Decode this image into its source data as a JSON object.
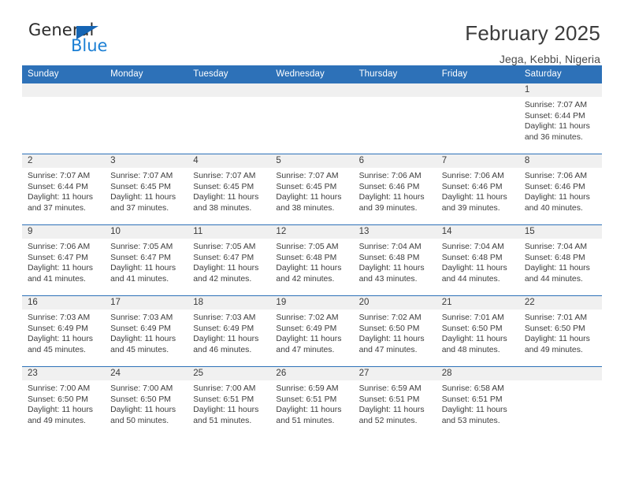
{
  "brand": {
    "word_general": "General",
    "word_blue": "Blue",
    "flag_color": "#1565b4",
    "blue_text_color": "#1b7fd4"
  },
  "header": {
    "title": "February 2025",
    "subtitle": "Jega, Kebbi, Nigeria"
  },
  "theme": {
    "header_blue": "#2d71b8",
    "band_gray": "#f0f0f0",
    "text": "#3a3a3a"
  },
  "weekday_headers": [
    "Sunday",
    "Monday",
    "Tuesday",
    "Wednesday",
    "Thursday",
    "Friday",
    "Saturday"
  ],
  "labels": {
    "sunrise_prefix": "Sunrise:",
    "sunset_prefix": "Sunset:",
    "daylight_prefix": "Daylight:"
  },
  "weeks": [
    [
      {
        "empty": true
      },
      {
        "empty": true
      },
      {
        "empty": true
      },
      {
        "empty": true
      },
      {
        "empty": true
      },
      {
        "empty": true
      },
      {
        "day": "1",
        "sunrise": "Sunrise: 7:07 AM",
        "sunset": "Sunset: 6:44 PM",
        "daylight": "Daylight: 11 hours and 36 minutes."
      }
    ],
    [
      {
        "day": "2",
        "sunrise": "Sunrise: 7:07 AM",
        "sunset": "Sunset: 6:44 PM",
        "daylight": "Daylight: 11 hours and 37 minutes."
      },
      {
        "day": "3",
        "sunrise": "Sunrise: 7:07 AM",
        "sunset": "Sunset: 6:45 PM",
        "daylight": "Daylight: 11 hours and 37 minutes."
      },
      {
        "day": "4",
        "sunrise": "Sunrise: 7:07 AM",
        "sunset": "Sunset: 6:45 PM",
        "daylight": "Daylight: 11 hours and 38 minutes."
      },
      {
        "day": "5",
        "sunrise": "Sunrise: 7:07 AM",
        "sunset": "Sunset: 6:45 PM",
        "daylight": "Daylight: 11 hours and 38 minutes."
      },
      {
        "day": "6",
        "sunrise": "Sunrise: 7:06 AM",
        "sunset": "Sunset: 6:46 PM",
        "daylight": "Daylight: 11 hours and 39 minutes."
      },
      {
        "day": "7",
        "sunrise": "Sunrise: 7:06 AM",
        "sunset": "Sunset: 6:46 PM",
        "daylight": "Daylight: 11 hours and 39 minutes."
      },
      {
        "day": "8",
        "sunrise": "Sunrise: 7:06 AM",
        "sunset": "Sunset: 6:46 PM",
        "daylight": "Daylight: 11 hours and 40 minutes."
      }
    ],
    [
      {
        "day": "9",
        "sunrise": "Sunrise: 7:06 AM",
        "sunset": "Sunset: 6:47 PM",
        "daylight": "Daylight: 11 hours and 41 minutes."
      },
      {
        "day": "10",
        "sunrise": "Sunrise: 7:05 AM",
        "sunset": "Sunset: 6:47 PM",
        "daylight": "Daylight: 11 hours and 41 minutes."
      },
      {
        "day": "11",
        "sunrise": "Sunrise: 7:05 AM",
        "sunset": "Sunset: 6:47 PM",
        "daylight": "Daylight: 11 hours and 42 minutes."
      },
      {
        "day": "12",
        "sunrise": "Sunrise: 7:05 AM",
        "sunset": "Sunset: 6:48 PM",
        "daylight": "Daylight: 11 hours and 42 minutes."
      },
      {
        "day": "13",
        "sunrise": "Sunrise: 7:04 AM",
        "sunset": "Sunset: 6:48 PM",
        "daylight": "Daylight: 11 hours and 43 minutes."
      },
      {
        "day": "14",
        "sunrise": "Sunrise: 7:04 AM",
        "sunset": "Sunset: 6:48 PM",
        "daylight": "Daylight: 11 hours and 44 minutes."
      },
      {
        "day": "15",
        "sunrise": "Sunrise: 7:04 AM",
        "sunset": "Sunset: 6:48 PM",
        "daylight": "Daylight: 11 hours and 44 minutes."
      }
    ],
    [
      {
        "day": "16",
        "sunrise": "Sunrise: 7:03 AM",
        "sunset": "Sunset: 6:49 PM",
        "daylight": "Daylight: 11 hours and 45 minutes."
      },
      {
        "day": "17",
        "sunrise": "Sunrise: 7:03 AM",
        "sunset": "Sunset: 6:49 PM",
        "daylight": "Daylight: 11 hours and 45 minutes."
      },
      {
        "day": "18",
        "sunrise": "Sunrise: 7:03 AM",
        "sunset": "Sunset: 6:49 PM",
        "daylight": "Daylight: 11 hours and 46 minutes."
      },
      {
        "day": "19",
        "sunrise": "Sunrise: 7:02 AM",
        "sunset": "Sunset: 6:49 PM",
        "daylight": "Daylight: 11 hours and 47 minutes."
      },
      {
        "day": "20",
        "sunrise": "Sunrise: 7:02 AM",
        "sunset": "Sunset: 6:50 PM",
        "daylight": "Daylight: 11 hours and 47 minutes."
      },
      {
        "day": "21",
        "sunrise": "Sunrise: 7:01 AM",
        "sunset": "Sunset: 6:50 PM",
        "daylight": "Daylight: 11 hours and 48 minutes."
      },
      {
        "day": "22",
        "sunrise": "Sunrise: 7:01 AM",
        "sunset": "Sunset: 6:50 PM",
        "daylight": "Daylight: 11 hours and 49 minutes."
      }
    ],
    [
      {
        "day": "23",
        "sunrise": "Sunrise: 7:00 AM",
        "sunset": "Sunset: 6:50 PM",
        "daylight": "Daylight: 11 hours and 49 minutes."
      },
      {
        "day": "24",
        "sunrise": "Sunrise: 7:00 AM",
        "sunset": "Sunset: 6:50 PM",
        "daylight": "Daylight: 11 hours and 50 minutes."
      },
      {
        "day": "25",
        "sunrise": "Sunrise: 7:00 AM",
        "sunset": "Sunset: 6:51 PM",
        "daylight": "Daylight: 11 hours and 51 minutes."
      },
      {
        "day": "26",
        "sunrise": "Sunrise: 6:59 AM",
        "sunset": "Sunset: 6:51 PM",
        "daylight": "Daylight: 11 hours and 51 minutes."
      },
      {
        "day": "27",
        "sunrise": "Sunrise: 6:59 AM",
        "sunset": "Sunset: 6:51 PM",
        "daylight": "Daylight: 11 hours and 52 minutes."
      },
      {
        "day": "28",
        "sunrise": "Sunrise: 6:58 AM",
        "sunset": "Sunset: 6:51 PM",
        "daylight": "Daylight: 11 hours and 53 minutes."
      },
      {
        "empty": true
      }
    ]
  ]
}
